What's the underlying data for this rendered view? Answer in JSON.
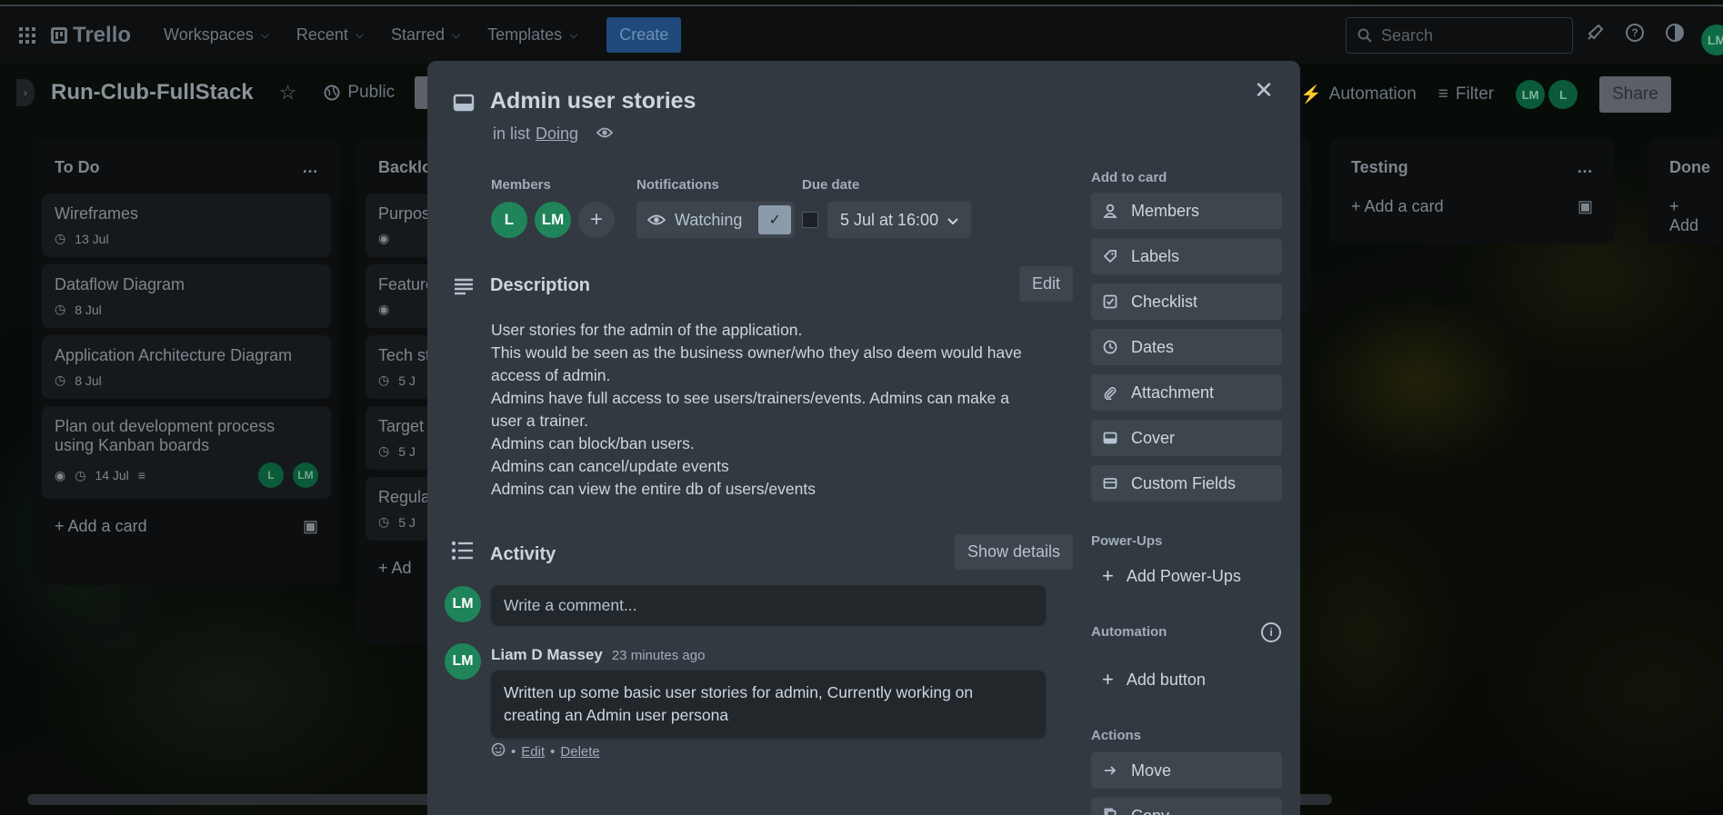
{
  "topnav": {
    "logo": "Trello",
    "menu": [
      {
        "label": "Workspaces"
      },
      {
        "label": "Recent"
      },
      {
        "label": "Starred"
      },
      {
        "label": "Templates"
      }
    ],
    "create_label": "Create",
    "search_placeholder": "Search",
    "avatar": "LM"
  },
  "board": {
    "title": "Run-Club-FullStack",
    "visibility": "Public",
    "automation": "Automation",
    "filter": "Filter",
    "share": "Share",
    "members": [
      "LM",
      "L"
    ]
  },
  "lists": [
    {
      "title": "To Do",
      "cards": [
        {
          "title": "Wireframes",
          "date": "13 Jul"
        },
        {
          "title": "Dataflow Diagram",
          "date": "8 Jul"
        },
        {
          "title": "Application Architecture Diagram",
          "date": "8 Jul"
        },
        {
          "title": "Plan out development process using Kanban boards",
          "date": "14 Jul",
          "members": [
            "L",
            "LM"
          ]
        }
      ],
      "add_card": "Add a card"
    },
    {
      "title": "Backlo",
      "cards": [
        {
          "title": "Purpos",
          "date": ""
        },
        {
          "title": "Feature",
          "date": ""
        },
        {
          "title": "Tech st",
          "date": "5 J"
        },
        {
          "title": "Target",
          "date": "5 J"
        },
        {
          "title": "Regula",
          "date": "5 J"
        }
      ],
      "add_card": "Ad"
    },
    {
      "title": "Testing",
      "cards": [],
      "add_card": "Add a card"
    },
    {
      "title": "Done",
      "cards": [],
      "add_card": "Add"
    }
  ],
  "modal": {
    "title": "Admin user stories",
    "in_list_prefix": "in list",
    "list_name": "Doing",
    "members_label": "Members",
    "members": [
      "L",
      "LM"
    ],
    "notifications_label": "Notifications",
    "watching": "Watching",
    "due_label": "Due date",
    "due_value": "5 Jul at 16:00",
    "description_label": "Description",
    "edit_label": "Edit",
    "description_lines": [
      "User stories for the admin of the application.",
      "This would be seen as the business owner/who they also deem would have access of admin.",
      "Admins have full access to see users/trainers/events. Admins can make a user a trainer.",
      "Admins can block/ban users.",
      "Admins can cancel/update events",
      "Admins can view the entire db of users/events"
    ],
    "activity_label": "Activity",
    "show_details": "Show details",
    "comment_avatar": "LM",
    "comment_placeholder": "Write a comment...",
    "comment": {
      "author_avatar": "LM",
      "author": "Liam D Massey",
      "time": "23 minutes ago",
      "text": "Written up some basic user stories for admin, Currently working on creating an Admin user persona",
      "edit": "Edit",
      "delete": "Delete",
      "sep": "•"
    },
    "sidebar": {
      "add_to_card": "Add to card",
      "add_items": [
        {
          "label": "Members",
          "icon": "person-icon"
        },
        {
          "label": "Labels",
          "icon": "tag-icon"
        },
        {
          "label": "Checklist",
          "icon": "checkbox-icon"
        },
        {
          "label": "Dates",
          "icon": "clock-icon"
        },
        {
          "label": "Attachment",
          "icon": "paperclip-icon"
        },
        {
          "label": "Cover",
          "icon": "cover-icon"
        },
        {
          "label": "Custom Fields",
          "icon": "custom-fields-icon"
        }
      ],
      "powerups_label": "Power-Ups",
      "add_powerups": "Add Power-Ups",
      "automation_label": "Automation",
      "add_button": "Add button",
      "actions_label": "Actions",
      "move": "Move",
      "copy": "Copy"
    }
  }
}
